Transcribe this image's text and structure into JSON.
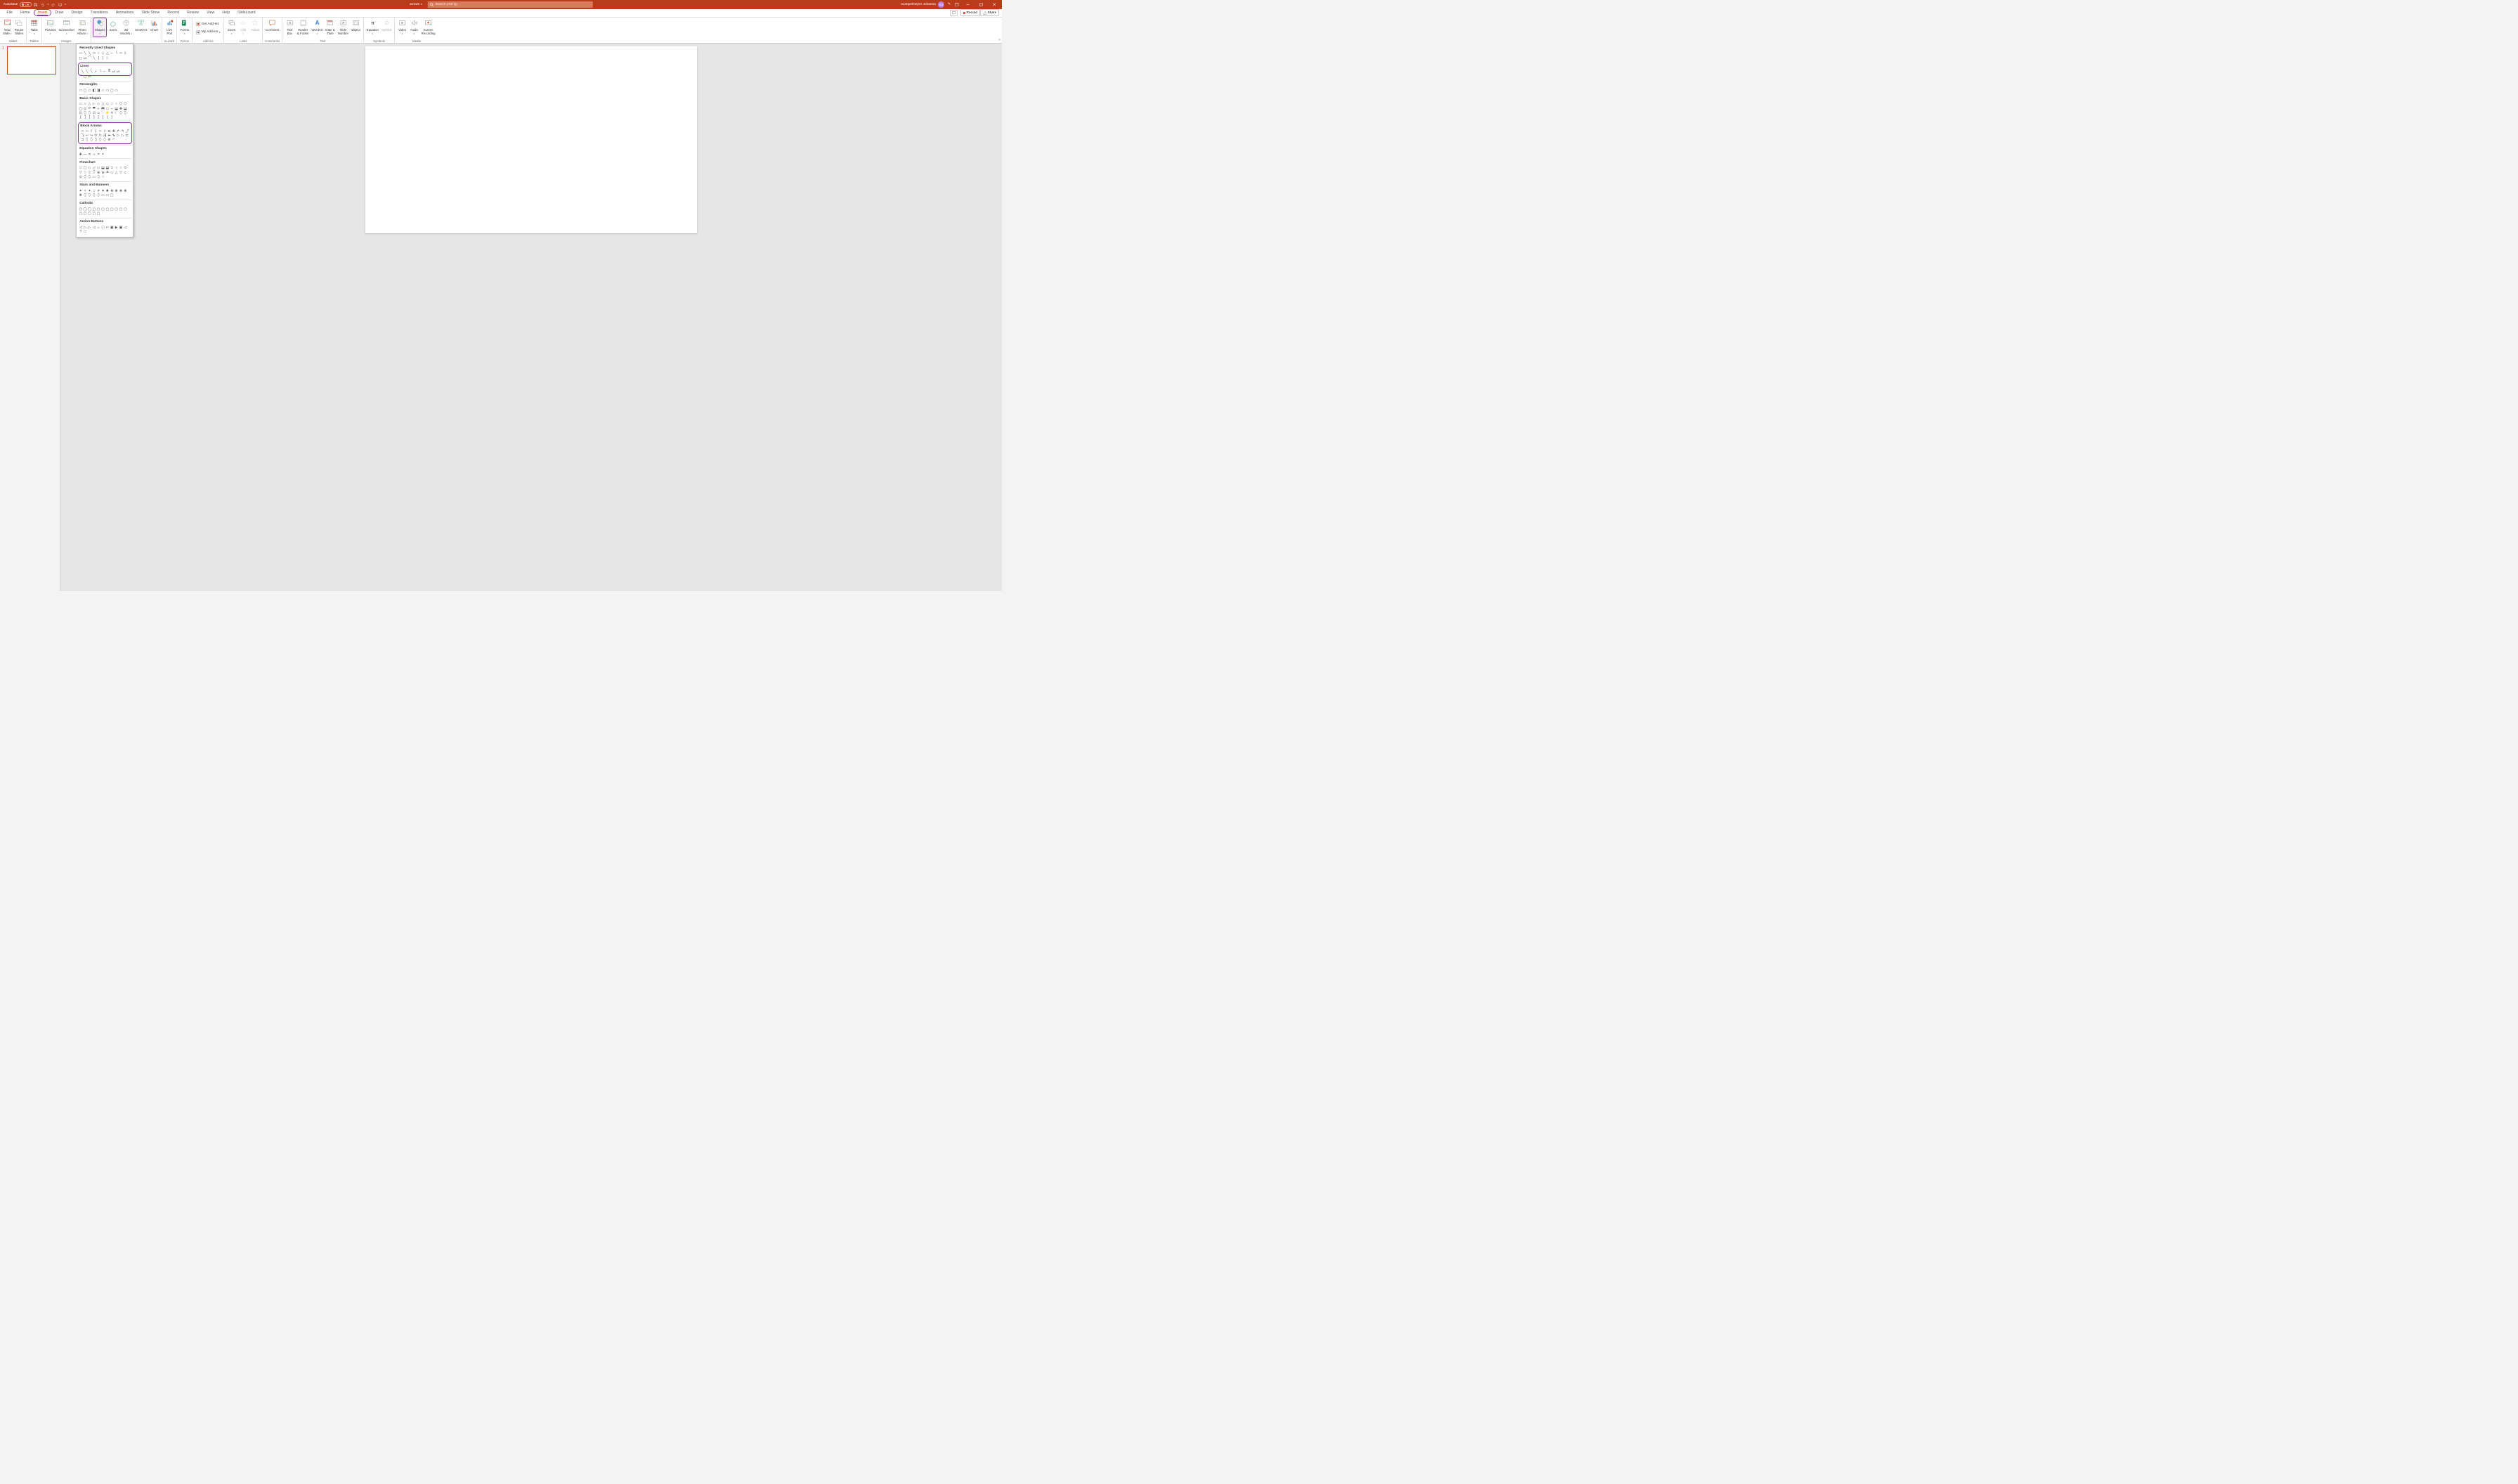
{
  "titlebar": {
    "autosave_label": "AutoSave",
    "autosave_state": "Off",
    "doc_name": "arrows",
    "search_placeholder": "Search (Alt+Q)",
    "user_name": "Gumpelmeyer Johanna",
    "user_initials": "GJ"
  },
  "tabs": {
    "file": "File",
    "home": "Home",
    "insert": "Insert",
    "draw": "Draw",
    "design": "Design",
    "transitions": "Transitions",
    "animations": "Animations",
    "slideshow": "Slide Show",
    "record": "Record",
    "review": "Review",
    "view": "View",
    "help": "Help",
    "slidelizard": "SlideLizard",
    "record_btn": "Record",
    "share_btn": "Share"
  },
  "ribbon": {
    "slides": {
      "new_slide": "New\nSlide",
      "reuse": "Reuse\nSlides",
      "group": "Slides"
    },
    "tables": {
      "table": "Table",
      "group": "Tables"
    },
    "images": {
      "pictures": "Pictures",
      "screenshot": "Screenshot",
      "photo_album": "Photo\nAlbum",
      "group": "Images"
    },
    "illus": {
      "shapes": "Shapes",
      "icons": "Icons",
      "models": "3D\nModels",
      "smartart": "SmartArt",
      "chart": "Chart"
    },
    "poll": {
      "live_poll": "Live\nPoll",
      "group": "eLizard"
    },
    "forms": {
      "forms": "Forms",
      "group": "Forms"
    },
    "addins": {
      "get": "Get Add-ins",
      "my": "My Add-ins",
      "group": "Add-ins"
    },
    "links": {
      "zoom": "Zoom",
      "link": "Link",
      "action": "Action",
      "group": "Links"
    },
    "comments": {
      "comment": "Comment",
      "group": "Comments"
    },
    "text": {
      "textbox": "Text\nBox",
      "header": "Header\n& Footer",
      "wordart": "WordArt",
      "date": "Date &\nTime",
      "slide_num": "Slide\nNumber",
      "object": "Object",
      "group": "Text"
    },
    "symbols": {
      "equation": "Equation",
      "symbol": "Symbol",
      "group": "Symbols"
    },
    "media": {
      "video": "Video",
      "audio": "Audio",
      "screen": "Screen\nRecording",
      "group": "Media"
    }
  },
  "slides_panel": {
    "num": "1"
  },
  "shapes": {
    "recent": "Recently Used Shapes",
    "lines": "Lines",
    "rectangles": "Rectangles",
    "basic": "Basic Shapes",
    "block_arrows": "Block Arrows",
    "equation": "Equation Shapes",
    "flowchart": "Flowchart",
    "stars": "Stars and Banners",
    "callouts": "Callouts",
    "action": "Action Buttons",
    "recent_items": [
      "▭",
      "╲",
      "╲",
      "□",
      "○",
      "◇",
      "△",
      "⌐",
      "└",
      "⇨",
      "⇩",
      "◻",
      "ᔕ",
      "⌒",
      "╲",
      "{",
      "}",
      "☆"
    ],
    "lines_items": [
      "╲",
      "╲",
      "╲",
      "⌐",
      "└",
      "⌐",
      "ᘔ",
      "ᔕ",
      "ᔕ"
    ],
    "lines_extra": [
      "⌒",
      "◻",
      "ᔕ"
    ],
    "rect_items": [
      "□",
      "▢",
      "▭",
      "◧",
      "◨",
      "▱",
      "▭",
      "▢",
      "▭"
    ],
    "basic_items": [
      "▭",
      "○",
      "△",
      "▷",
      "◇",
      "△",
      "◇",
      "○",
      "○",
      "⬡",
      "⬡",
      "◯",
      "⊙",
      "⬭",
      "⬬",
      "◐",
      "⬒",
      "□",
      "⌐",
      "⬓",
      "✚",
      "⬓",
      "⊡",
      "⬯",
      "⬯",
      "⊡",
      "☺",
      "♡",
      "⚡",
      "☀",
      "☾",
      "⬯",
      "⬯",
      "[",
      "]",
      "{",
      "}",
      "[",
      "]",
      "{",
      "}"
    ],
    "block_items": [
      "⇨",
      "⇦",
      "⇧",
      "⇩",
      "⬄",
      "⇳",
      "⬌",
      "✚",
      "↱",
      "↰",
      "⤴",
      "⤵",
      "↩",
      "↪",
      "⟳",
      "↻",
      "⇶",
      "⬅",
      "⬊",
      "▷",
      "▷",
      "⊏",
      "⊐",
      "⬯",
      "⬯",
      "⬯",
      "⬯",
      "⬯",
      "⊕",
      "◠"
    ],
    "eq_items": [
      "✚",
      "—",
      "✕",
      "÷",
      "=",
      "≠"
    ],
    "flow_items": [
      "□",
      "▢",
      "◇",
      "▱",
      "▭",
      "⬓",
      "⬓",
      "⊃",
      "○",
      "○",
      "⬭",
      "▽",
      "○",
      "⊂",
      "⬯",
      "⊗",
      "⊕",
      "⧖",
      "◇",
      "△",
      "▽",
      "⊂",
      "⬭",
      "⬯",
      "⬯",
      "▭",
      "⬯",
      "○"
    ],
    "star_items": [
      "✦",
      "✧",
      "✦",
      "☆",
      "✶",
      "✷",
      "✸",
      "❋",
      "❋",
      "❋",
      "❋",
      "❋",
      "⬯",
      "⬯",
      "⬯",
      "⬯",
      "▭",
      "▭",
      "▢"
    ],
    "call_items": [
      "▢",
      "◯",
      "◯",
      "▢",
      "▢",
      "▢",
      "▢",
      "▢",
      "▢",
      "▢",
      "▢",
      "▢",
      "▢",
      "▢",
      "▢",
      "▢"
    ],
    "action_items": [
      "◁",
      "▷",
      "▷",
      "◁",
      "⌂",
      "ⓘ",
      "↩",
      "▣",
      "▶",
      "▣",
      "◁",
      "?",
      "□"
    ]
  }
}
